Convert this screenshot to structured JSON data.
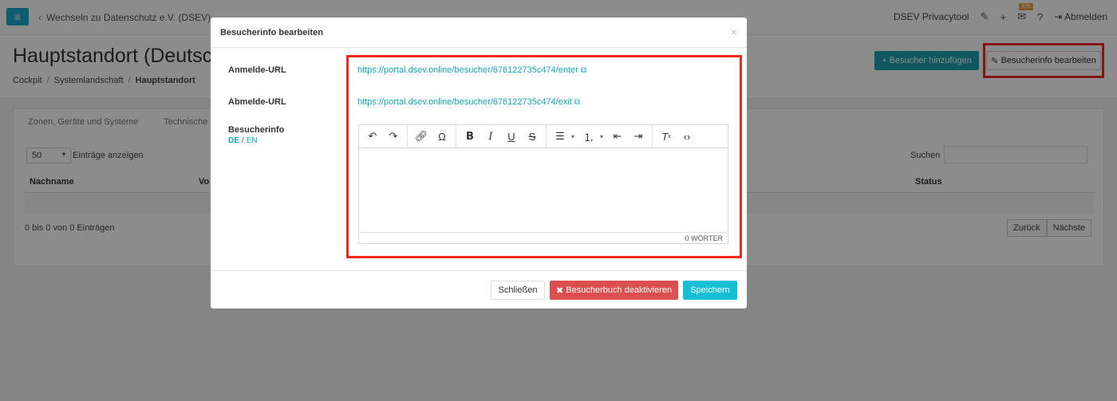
{
  "topbar": {
    "back_link": "Wechseln zu Datenschutz e.V. (DSEV)",
    "app_name": "DSEV Privacytool",
    "badge_count": "436",
    "logout": "Abmelden"
  },
  "header": {
    "title": "Hauptstandort (Deutschland)",
    "breadcrumb": [
      "Cockpit",
      "Systemlandschaft",
      "Hauptstandort"
    ],
    "add_visitor": "Besucher hinzufügen",
    "edit_visitor_info": "Besucherinfo bearbeiten"
  },
  "panel": {
    "tabs": [
      "Zonen, Geräte und Systeme",
      "Technische"
    ],
    "page_length": "50",
    "length_label": "Einträge anzeigen",
    "search_label": "Suchen",
    "columns": [
      "Nachname",
      "Vo",
      "Status"
    ],
    "info": "0 bis 0 von 0 Einträgen",
    "prev": "Zurück",
    "next": "Nächste"
  },
  "modal": {
    "title": "Besucherinfo bearbeiten",
    "close_glyph": "×",
    "login_label": "Anmelde-URL",
    "login_url": "https://portal.dsev.online/besucher/676122735c474/enter",
    "logout_label": "Abmelde-URL",
    "logout_url": "https://portal.dsev.online/besucher/676122735c474/exit",
    "info_label": "Besucherinfo",
    "lang_de": "DE",
    "lang_en": "EN",
    "word_count": "0 WÖRTER",
    "btn_close": "Schließen",
    "btn_deactivate": "Besucherbuch deaktivieren",
    "btn_save": "Speichern"
  },
  "colors": {
    "accent": "#17bfd5",
    "teal_button": "#1aa0b0",
    "danger": "#dc4f4f",
    "highlight": "#ef2b1f",
    "link": "#14a3bd"
  }
}
